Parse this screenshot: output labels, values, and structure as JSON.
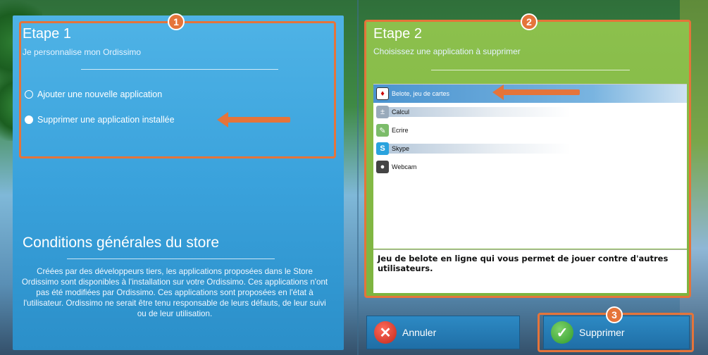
{
  "step1": {
    "badge": "1",
    "title": "Etape 1",
    "subtitle": "Je personnalise mon Ordissimo",
    "options": [
      {
        "label": "Ajouter une nouvelle application",
        "checked": false
      },
      {
        "label": "Supprimer une application installée",
        "checked": true
      }
    ]
  },
  "conditions": {
    "title": "Conditions générales du store",
    "text": "Créées par des développeurs tiers, les applications proposées dans le Store Ordissimo sont disponibles à l'installation sur votre Ordissimo. Ces applications n'ont pas été modifiées par Ordissimo. Ces applications sont proposées en l'état à l'utilisateur. Ordissimo ne serait être tenu responsable de leurs défauts, de leur suivi ou de leur utilisation."
  },
  "step2": {
    "badge": "2",
    "title": "Etape 2",
    "subtitle": "Choisissez une application à supprimer",
    "apps": [
      {
        "label": "Belote, jeu de cartes",
        "icon": "cards-icon",
        "selected": true
      },
      {
        "label": "Calcul",
        "icon": "calculator-icon",
        "selected": false
      },
      {
        "label": "Ecrire",
        "icon": "write-icon",
        "selected": false
      },
      {
        "label": "Skype",
        "icon": "skype-icon",
        "selected": false
      },
      {
        "label": "Webcam",
        "icon": "webcam-icon",
        "selected": false
      }
    ],
    "description": "Jeu de belote en ligne qui vous permet de jouer contre d'autres utilisateurs."
  },
  "buttons": {
    "badge3": "3",
    "cancel_label": "Annuler",
    "delete_label": "Supprimer"
  },
  "colors": {
    "accent_orange": "#e5743a",
    "panel_blue": "#3aa2dc",
    "panel_green": "#7db43f"
  }
}
